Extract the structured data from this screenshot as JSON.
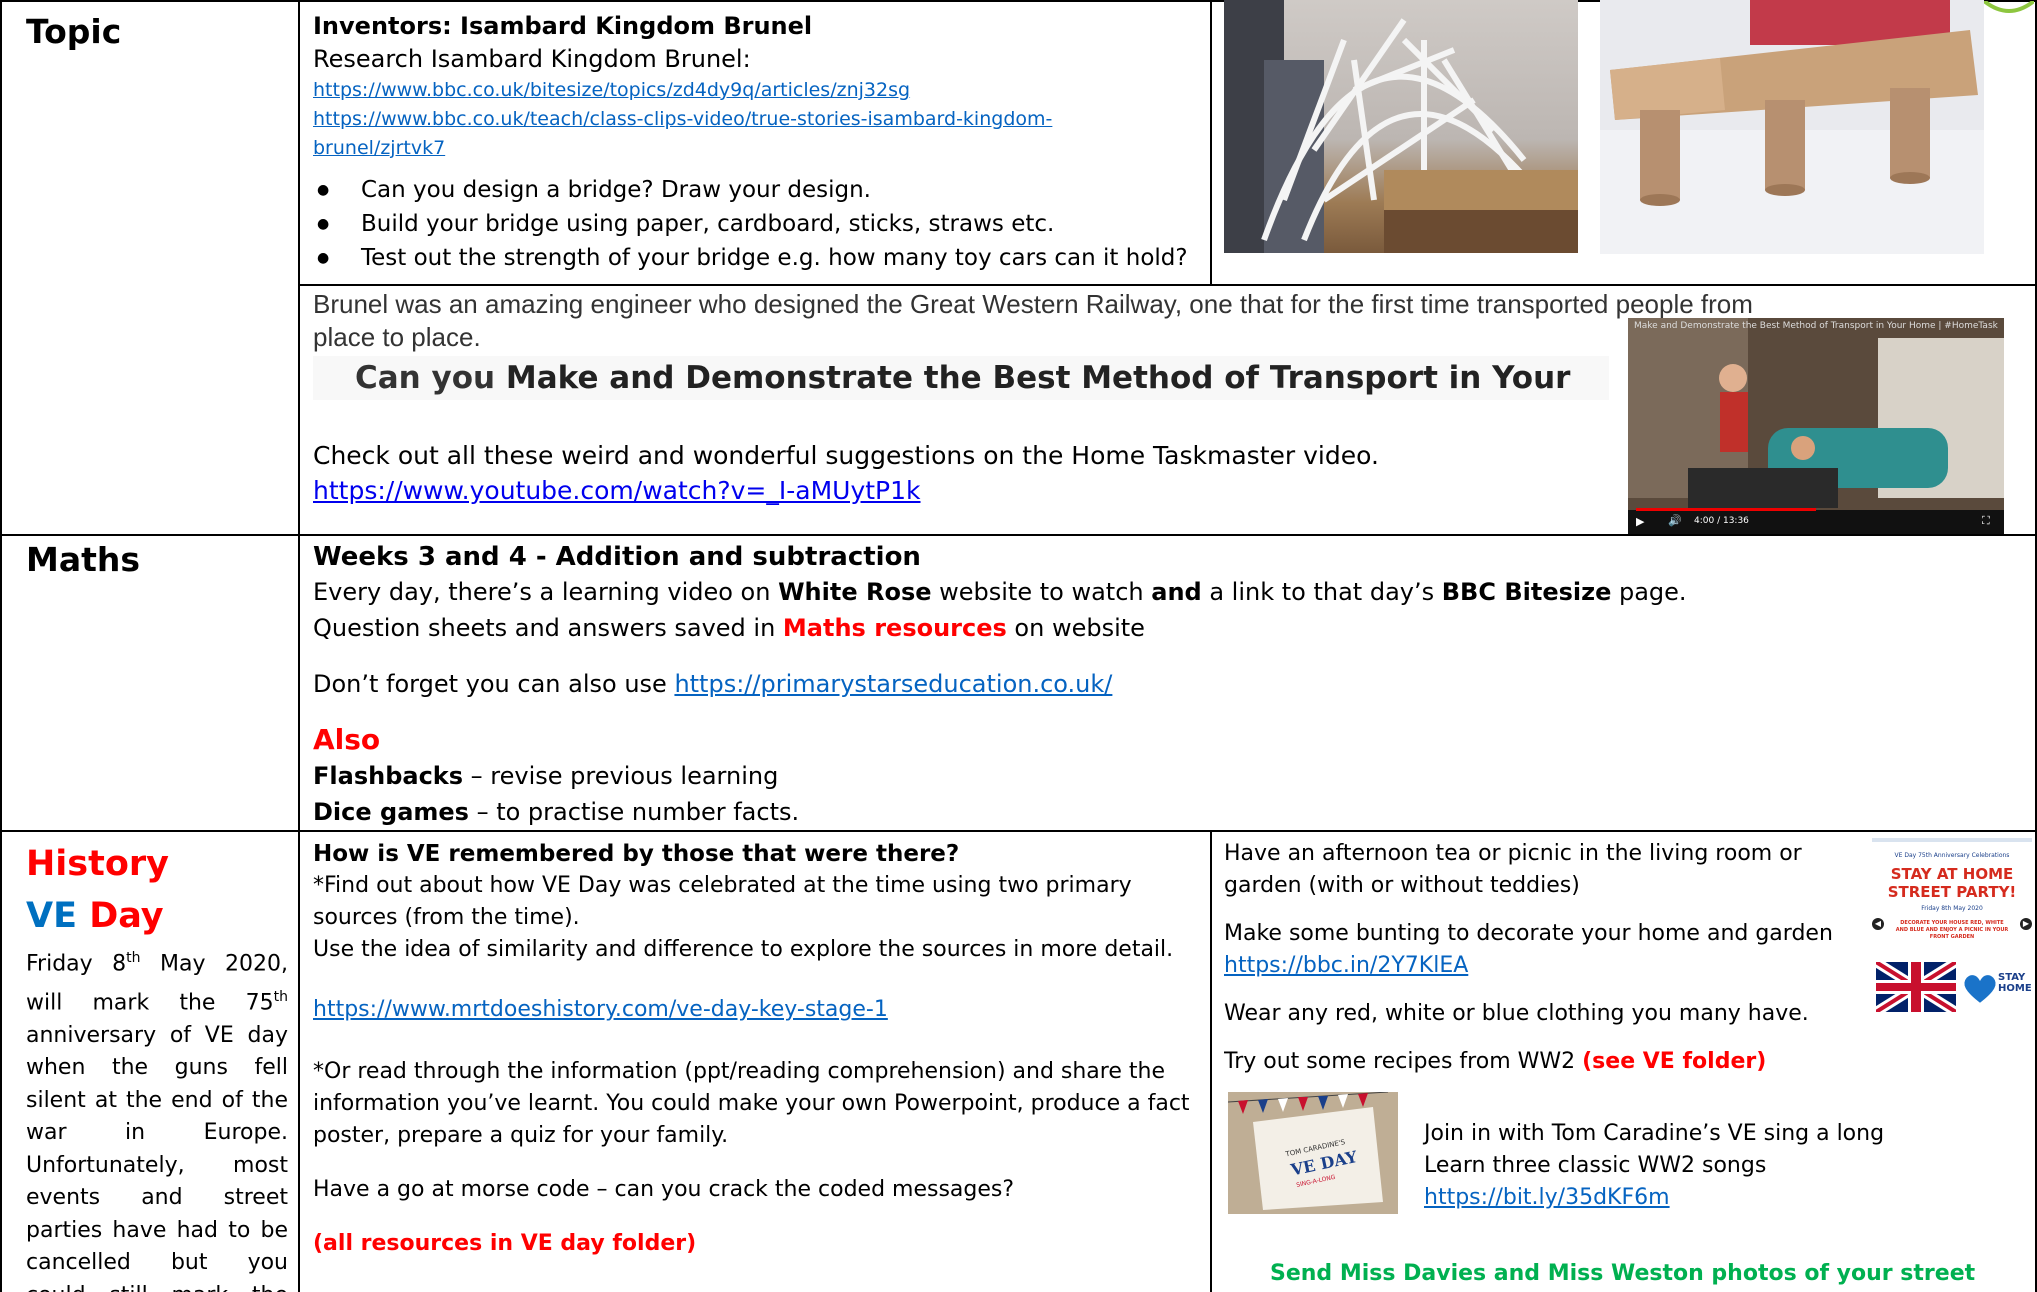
{
  "topic": {
    "label": "Topic",
    "title": "Inventors: Isambard Kingdom Brunel",
    "research": "Research Isambard Kingdom Brunel:",
    "link1": "https://www.bbc.co.uk/bitesize/topics/zd4dy9q/articles/znj32sg",
    "link2a": "https://www.bbc.co.uk/teach/class-clips-video/true-stories-isambard-kingdom-",
    "link2b": "brunel/zjrtvk7",
    "bullets": [
      "Can you design a bridge? Draw your design.",
      "Build your bridge using paper, cardboard, sticks, straws etc.",
      "Test out the strength of your bridge e.g. how many toy cars can it hold?"
    ],
    "brunel_line1": "Brunel was an amazing engineer who designed the Great Western Railway, one that for the first time transported people from",
    "brunel_line2": "place to place.",
    "challenge_pre": "Can you ",
    "challenge_bold": "Make and Demonstrate the Best Method of Transport in Your Home?",
    "check_out": "Check out all these weird and wonderful suggestions on the Home Taskmaster video.",
    "youtube_link": "https://www.youtube.com/watch?v=_I-aMUytP1k",
    "video_title": "Make and Demonstrate the Best Method of Transport in Your Home | #HomeTasking #StayHome",
    "video_time": "4:00 / 13:36"
  },
  "maths": {
    "label": "Maths",
    "title": "Weeks 3 and 4 - Addition and subtraction",
    "line1_a": "Every day, there’s a learning video on ",
    "line1_b": "White Rose",
    "line1_c": " website to watch ",
    "line1_d": "and",
    "line1_e": " a link to that day’s ",
    "line1_f": "BBC Bitesize",
    "line1_g": " page.",
    "line2_a": "Question sheets and answers saved in ",
    "line2_b": "Maths resources",
    "line2_c": " on website",
    "line3_a": "Don’t forget you can also use ",
    "line3_link": "https://primarystarseducation.co.uk/",
    "also": "Also",
    "flash_b": "Flashbacks",
    "flash_t": " – revise previous learning",
    "dice_b": "Dice games",
    "dice_t": "  – to practise number facts."
  },
  "history": {
    "label": "History",
    "ve": "VE",
    "day": "Day",
    "para_a": "Friday 8",
    "para_sup1": "th",
    "para_b": " May 2020, will mark the 75",
    "para_sup2": "th",
    "para_c": " anniversary of VE day when the guns fell silent at the end of the war in Europe. Unfortunately, most events and street parties have had to be cancelled but you could still mark the occasion at home.",
    "q_title": "How is VE remembered by those that were there?",
    "q1": "*Find out about how VE Day was celebrated at the time using two primary sources (from the time).",
    "q2": "Use the idea of similarity and difference to explore the sources in more detail.",
    "link": "https://www.mrtdoeshistory.com/ve-day-key-stage-1",
    "q3": "*Or read through the information (ppt/reading comprehension) and share the information you’ve learnt. You could make your own Powerpoint, produce a fact poster, prepare a quiz for your family.",
    "q4": "Have a go at morse code – can you crack the coded messages?",
    "q5": "(all resources in VE day folder)",
    "r1": "Have an afternoon tea or picnic in the living room or garden (with or without teddies)",
    "r2": "Make some bunting to decorate your home and garden",
    "r2_link": "https://bbc.in/2Y7KlEA",
    "r3": "Wear any red, white or blue clothing you many have.",
    "r4_a": "Try out some recipes from WW2 ",
    "r4_b": "(see VE folder)",
    "r5": "Join in with Tom Caradine’s VE sing a long",
    "r6": "Learn three classic WW2 songs",
    "r6_link": "https://bit.ly/35dKF6m",
    "r7": "Send Miss Davies and Miss Weston photos of your street party!",
    "poster_top": "VE Day 75th Anniversary Celebrations",
    "poster_title1": "STAY AT HOME",
    "poster_title2": "STREET PARTY!",
    "poster_date": "Friday 8th May 2020",
    "poster_sub": "DECORATE YOUR HOUSE RED, WHITE AND BLUE AND ENJOY A PICNIC IN YOUR FRONT GARDEN",
    "poster_stay1": "STAY",
    "poster_stay2": "HOME",
    "card_text1": "TOM CARADINE'S",
    "card_text2": "VE DAY",
    "card_text3": "SING-A-LONG"
  },
  "colors": {
    "red": "#ff0000",
    "blue": "#0070c0",
    "link": "#0563c1",
    "green": "#00b050"
  }
}
